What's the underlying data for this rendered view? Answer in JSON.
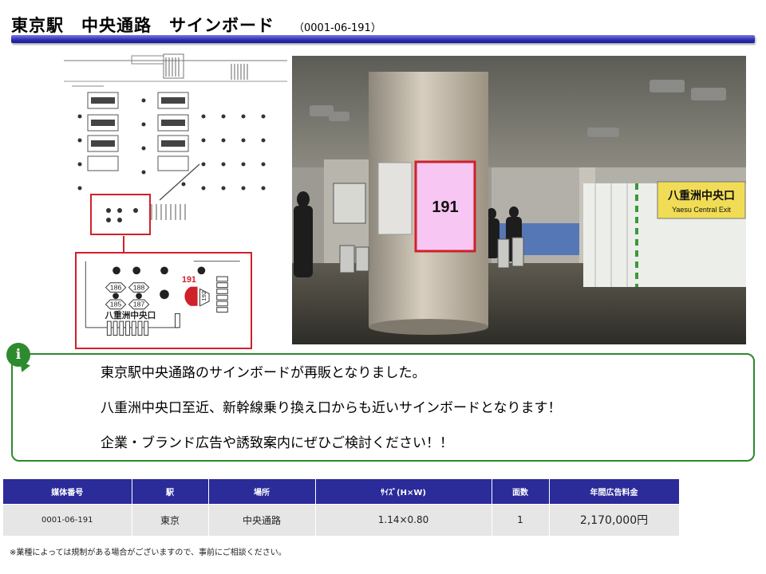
{
  "header": {
    "title": "東京駅　中央通路　サインボード",
    "code": "（0001-06-191）"
  },
  "map": {
    "highlight_label": "191",
    "bubble_labels": [
      "186",
      "188",
      "185",
      "187"
    ],
    "side_label": "192",
    "exit_label": "八重洲中央口"
  },
  "photo": {
    "sign_label": "191",
    "exit_sign_jp": "八重洲中央口",
    "exit_sign_en": "Yaesu Central Exit"
  },
  "info": {
    "lines": [
      "東京駅中央通路のサインボードが再販となりました。",
      "八重洲中央口至近、新幹線乗り換え口からも近いサインボードとなります！",
      "企業・ブランド広告や誘致案内にぜひご検討ください！！"
    ]
  },
  "table": {
    "headers": [
      "媒体番号",
      "駅",
      "場所",
      "ｻｲｽﾞ(H×W)",
      "面数",
      "年間広告料金"
    ],
    "row": [
      "0001-06-191",
      "東京",
      "中央通路",
      "1.14×0.80",
      "1",
      "2,170,000円"
    ]
  },
  "note": "※業種によっては規制がある場合がございますので、事前にご相談ください。",
  "colors": {
    "title_bar": "#2b2bb8",
    "info_border": "#2e8a2e",
    "table_header": "#2b2b9a",
    "highlight": "#d0202a",
    "sign_fill": "#f7c6f2"
  }
}
